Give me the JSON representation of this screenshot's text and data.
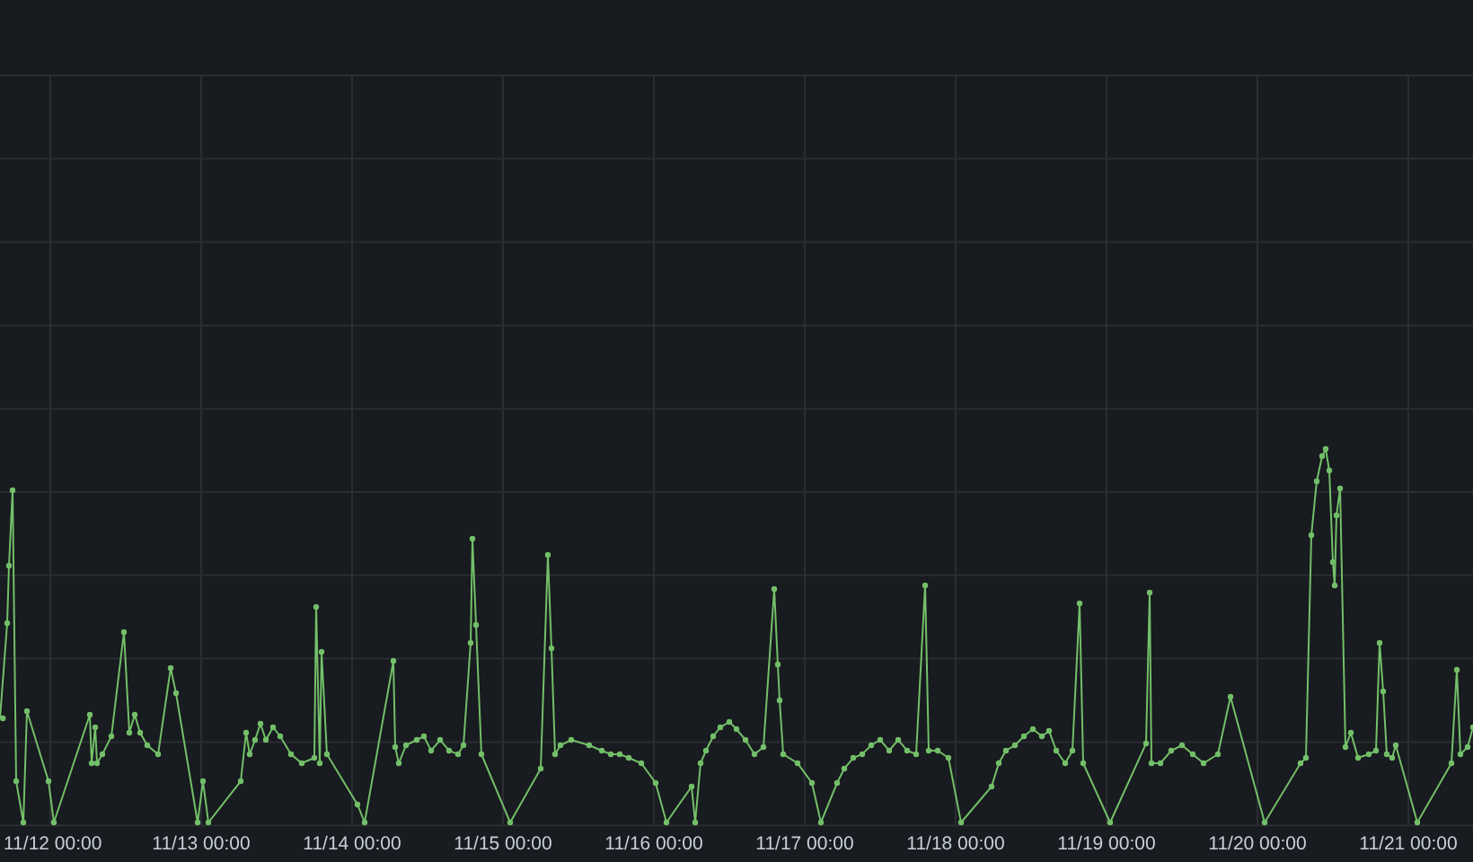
{
  "chart": {
    "x_labels": [
      "11/12 00:00",
      "11/13 00:00",
      "11/14 00:00",
      "11/15 00:00",
      "11/16 00:00",
      "11/17 00:00",
      "11/18 00:00",
      "11/19 00:00",
      "11/20 00:00",
      "11/21 00:00"
    ]
  }
}
